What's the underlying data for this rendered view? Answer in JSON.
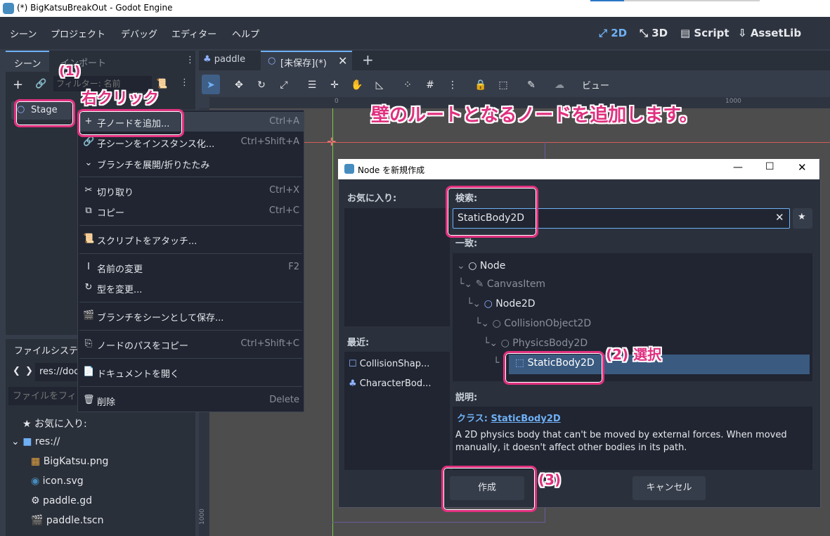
{
  "window": {
    "title": "(*) BigKatsuBreakOut - Godot Engine"
  },
  "menu": [
    "シーン",
    "プロジェクト",
    "デバッグ",
    "エディター",
    "ヘルプ"
  ],
  "workspaces": [
    {
      "label": "2D",
      "icon": "⤢",
      "active": true
    },
    {
      "label": "3D",
      "icon": "⤡",
      "active": false
    },
    {
      "label": "Script",
      "icon": "▤",
      "active": false
    },
    {
      "label": "AssetLib",
      "icon": "⇩",
      "active": false
    }
  ],
  "scene_dock": {
    "tabs": [
      "シーン",
      "インポート"
    ],
    "filter_placeholder": "フィルター: 名前",
    "root_node": "Stage"
  },
  "editor_tabs": [
    {
      "label": "paddle",
      "active": false
    },
    {
      "label": "[未保存](*)",
      "active": true
    }
  ],
  "toolbar": {
    "view_label": "ビュー"
  },
  "context_menu": {
    "items": [
      {
        "icon": "+",
        "label": "子ノードを追加...",
        "shortcut": "Ctrl+A"
      },
      {
        "icon": "🔗",
        "label": "子シーンをインスタンス化...",
        "shortcut": "Ctrl+Shift+A"
      },
      {
        "icon": "⌄",
        "label": "ブランチを展開/折りたたみ",
        "shortcut": ""
      },
      {
        "icon": "✂",
        "label": "切り取り",
        "shortcut": "Ctrl+X"
      },
      {
        "icon": "⧉",
        "label": "コピー",
        "shortcut": "Ctrl+C"
      },
      {
        "icon": "📜",
        "label": "スクリプトをアタッチ...",
        "shortcut": ""
      },
      {
        "icon": "I",
        "label": "名前の変更",
        "shortcut": "F2"
      },
      {
        "icon": "↻",
        "label": "型を変更...",
        "shortcut": ""
      },
      {
        "icon": "🎬",
        "label": "ブランチをシーンとして保存...",
        "shortcut": ""
      },
      {
        "icon": "⎘",
        "label": "ノードのパスをコピー",
        "shortcut": "Ctrl+Shift+C"
      },
      {
        "icon": "📄",
        "label": "ドキュメントを開く",
        "shortcut": ""
      },
      {
        "icon": "🗑",
        "label": "削除",
        "shortcut": "Delete"
      }
    ]
  },
  "filesystem": {
    "tab": "ファイルシステム",
    "path": "res://doc",
    "filter_placeholder": "ファイルをフィ",
    "favorites_label": "お気に入り:",
    "root": "res://",
    "files": [
      {
        "name": "BigKatsu.png",
        "icon": "▦",
        "color": "#e8a440"
      },
      {
        "name": "icon.svg",
        "icon": "◉",
        "color": "#478cbf"
      },
      {
        "name": "paddle.gd",
        "icon": "⚙",
        "color": "#e6e8ec"
      },
      {
        "name": "paddle.tscn",
        "icon": "🎬",
        "color": "#e6e8ec"
      }
    ]
  },
  "viewport": {
    "ruler_0": "0",
    "ruler_1000": "1000",
    "ruler_left_1000": "1000"
  },
  "dialog": {
    "title": "Node を新規作成",
    "favorites_label": "お気に入り:",
    "recent_label": "最近:",
    "recent": [
      {
        "name": "CollisionShap...",
        "icon": "☐",
        "color": "#8fb2ff"
      },
      {
        "name": "CharacterBod...",
        "icon": "♣",
        "color": "#8fb2ff"
      }
    ],
    "search_label": "検索:",
    "search_value": "StaticBody2D",
    "match_label": "一致:",
    "tree": [
      {
        "label": "Node",
        "indent": 0,
        "icon": "○",
        "color": "#e6e8ec",
        "dim": false
      },
      {
        "label": "CanvasItem",
        "indent": 1,
        "icon": "✎",
        "color": "#8a909a",
        "dim": true
      },
      {
        "label": "Node2D",
        "indent": 2,
        "icon": "○",
        "color": "#8fb2ff",
        "dim": false
      },
      {
        "label": "CollisionObject2D",
        "indent": 3,
        "icon": "○",
        "color": "#8a909a",
        "dim": true
      },
      {
        "label": "PhysicsBody2D",
        "indent": 4,
        "icon": "○",
        "color": "#8a909a",
        "dim": true
      },
      {
        "label": "StaticBody2D",
        "indent": 5,
        "icon": "⬚",
        "color": "#8fb2ff",
        "dim": false
      }
    ],
    "description_label": "説明:",
    "class_prefix": "クラス:",
    "class_name": "StaticBody2D",
    "description": "A 2D physics body that can't be moved by external forces. When moved manually, it doesn't affect other bodies in its path.",
    "create_button": "作成",
    "cancel_button": "キャンセル"
  },
  "annotations": {
    "step1": "(1)",
    "right_click": "右クリック",
    "headline": "壁のルートとなるノードを追加します。",
    "step2": "(2) 選択",
    "step3": "(3)"
  },
  "colors": {
    "accent": "#6fb0f5",
    "annotation": "#e0307f",
    "selection": "#3a5a80"
  }
}
